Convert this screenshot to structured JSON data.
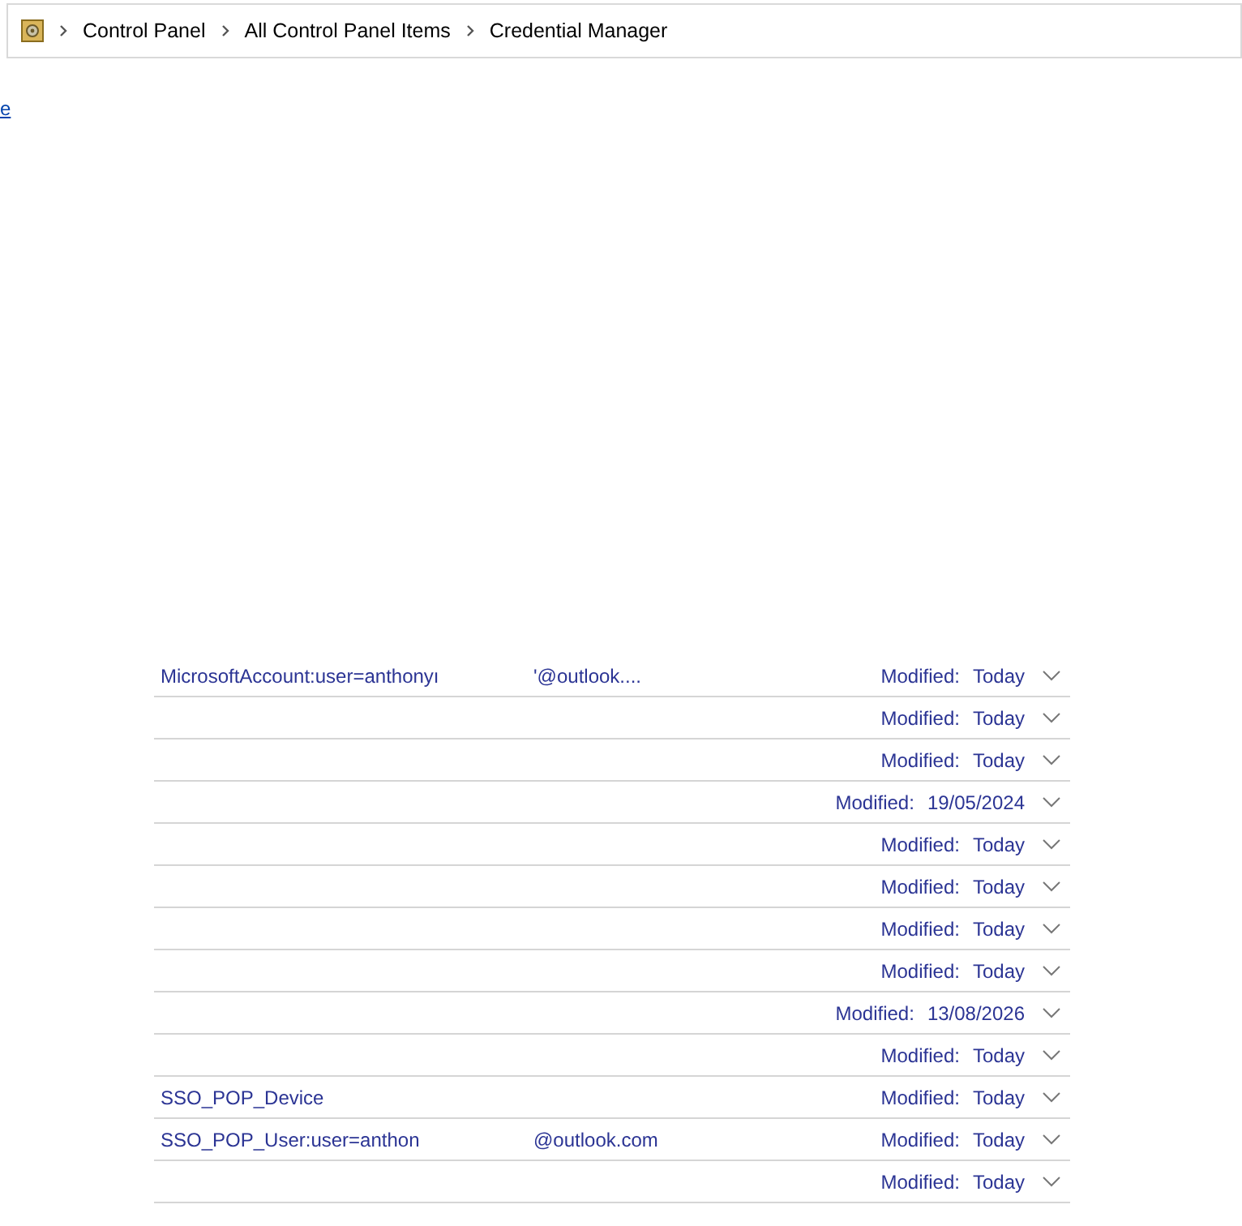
{
  "breadcrumb": [
    "Control Panel",
    "All Control Panel Items",
    "Credential Manager"
  ],
  "side_link": "e",
  "credentials": [
    {
      "name": "MicrosoftAccount:user=anthonyı",
      "account": "'@outlook....",
      "modified_label": "Modified:",
      "modified": "Today",
      "expanded": false
    },
    {
      "modified_label": "Modified:",
      "modified": "Today",
      "expanded": false
    },
    {
      "modified_label": "Modified:",
      "modified": "Today",
      "expanded": false
    },
    {
      "modified_label": "Modified:",
      "modified": "19/05/2024",
      "expanded": false
    },
    {
      "modified_label": "Modified:",
      "modified": "Today",
      "expanded": false
    },
    {
      "modified_label": "Modified:",
      "modified": "Today",
      "expanded": false
    },
    {
      "modified_label": "Modified:",
      "modified": "Today",
      "expanded": false
    },
    {
      "modified_label": "Modified:",
      "modified": "Today",
      "expanded": false
    },
    {
      "modified_label": "Modified:",
      "modified": "13/08/2026",
      "expanded": false
    },
    {
      "modified_label": "Modified:",
      "modified": "Today",
      "expanded": false
    },
    {
      "name": "SSO_POP_Device",
      "modified_label": "Modified:",
      "modified": "Today",
      "expanded": false
    },
    {
      "name": "SSO_POP_User:user=anthon",
      "account": "@outlook.com",
      "modified_label": "Modified:",
      "modified": "Today",
      "expanded": false
    },
    {
      "modified_label": "Modified:",
      "modified": "Today",
      "expanded": false
    }
  ]
}
